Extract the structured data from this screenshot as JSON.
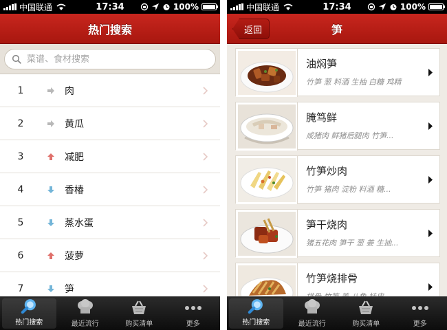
{
  "status": {
    "carrier": "中国联通",
    "time": "17:34",
    "battery": "100%"
  },
  "left": {
    "nav_title": "热门搜索",
    "search": {
      "placeholder": "菜谱、食材搜索"
    },
    "hot_items": [
      {
        "rank": "1",
        "label": "肉",
        "trend": "flat"
      },
      {
        "rank": "2",
        "label": "黄瓜",
        "trend": "flat"
      },
      {
        "rank": "3",
        "label": "减肥",
        "trend": "up"
      },
      {
        "rank": "4",
        "label": "香椿",
        "trend": "down"
      },
      {
        "rank": "5",
        "label": "蒸水蛋",
        "trend": "down"
      },
      {
        "rank": "6",
        "label": "菠萝",
        "trend": "up"
      },
      {
        "rank": "7",
        "label": "笋",
        "trend": "down"
      }
    ]
  },
  "right": {
    "back_label": "返回",
    "nav_title": "笋",
    "recipes": [
      {
        "name": "油焖笋",
        "ingredients": "竹笋 葱 料酒 生抽 白糖 鸡精"
      },
      {
        "name": "腌笃鲜",
        "ingredients": "咸猪肉 鲜猪后腿肉 竹笋..."
      },
      {
        "name": "竹笋炒肉",
        "ingredients": "竹笋 猪肉 淀粉 料酒 糖..."
      },
      {
        "name": "笋干烧肉",
        "ingredients": "猪五花肉 笋干 葱 姜 生抽..."
      },
      {
        "name": "竹笋烧排骨",
        "ingredients": "排骨 竹笋 姜 八角 桂皮"
      }
    ]
  },
  "tabs": [
    {
      "label": "热门搜索",
      "icon": "search-icon",
      "active": true
    },
    {
      "label": "最近流行",
      "icon": "chef-hat-icon",
      "active": false
    },
    {
      "label": "购买清单",
      "icon": "basket-icon",
      "active": false
    },
    {
      "label": "更多",
      "icon": "more-dots-icon",
      "active": false
    }
  ],
  "colors": {
    "nav_red": "#b61d15",
    "up": "#e0706b",
    "down": "#73b5d8",
    "flat": "#b8b8b8"
  }
}
